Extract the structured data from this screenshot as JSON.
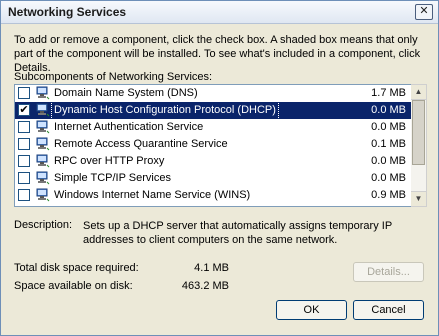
{
  "window": {
    "title": "Networking Services",
    "close_glyph": "✕"
  },
  "intro": "To add or remove a component, click the check box. A shaded box means that only part of the component will be installed. To see what's included in a component, click Details.",
  "subcomponents_label": "Subcomponents of Networking Services:",
  "components": [
    {
      "name": "Domain Name System (DNS)",
      "size": "1.7 MB",
      "checked": false,
      "selected": false,
      "icon": "network-computer-icon"
    },
    {
      "name": "Dynamic Host Configuration Protocol (DHCP)",
      "size": "0.0 MB",
      "checked": true,
      "selected": true,
      "icon": "network-computer-icon"
    },
    {
      "name": "Internet Authentication Service",
      "size": "0.0 MB",
      "checked": false,
      "selected": false,
      "icon": "network-computer-icon"
    },
    {
      "name": "Remote Access Quarantine Service",
      "size": "0.1 MB",
      "checked": false,
      "selected": false,
      "icon": "network-computer-icon"
    },
    {
      "name": "RPC over HTTP Proxy",
      "size": "0.0 MB",
      "checked": false,
      "selected": false,
      "icon": "network-computer-icon"
    },
    {
      "name": "Simple TCP/IP Services",
      "size": "0.0 MB",
      "checked": false,
      "selected": false,
      "icon": "network-computer-icon"
    },
    {
      "name": "Windows Internet Name Service (WINS)",
      "size": "0.9 MB",
      "checked": false,
      "selected": false,
      "icon": "network-computer-icon"
    }
  ],
  "description": {
    "label": "Description:",
    "text": "Sets up a DHCP server that automatically assigns temporary IP addresses to client computers on the same network."
  },
  "disk": {
    "required_label": "Total disk space required:",
    "required_value": "4.1 MB",
    "available_label": "Space available on disk:",
    "available_value": "463.2 MB"
  },
  "buttons": {
    "details": "Details...",
    "ok": "OK",
    "cancel": "Cancel"
  },
  "colors": {
    "selection": "#0a246a",
    "dialog_bg": "#ece9d8",
    "checkbox_border": "#1c5180"
  }
}
